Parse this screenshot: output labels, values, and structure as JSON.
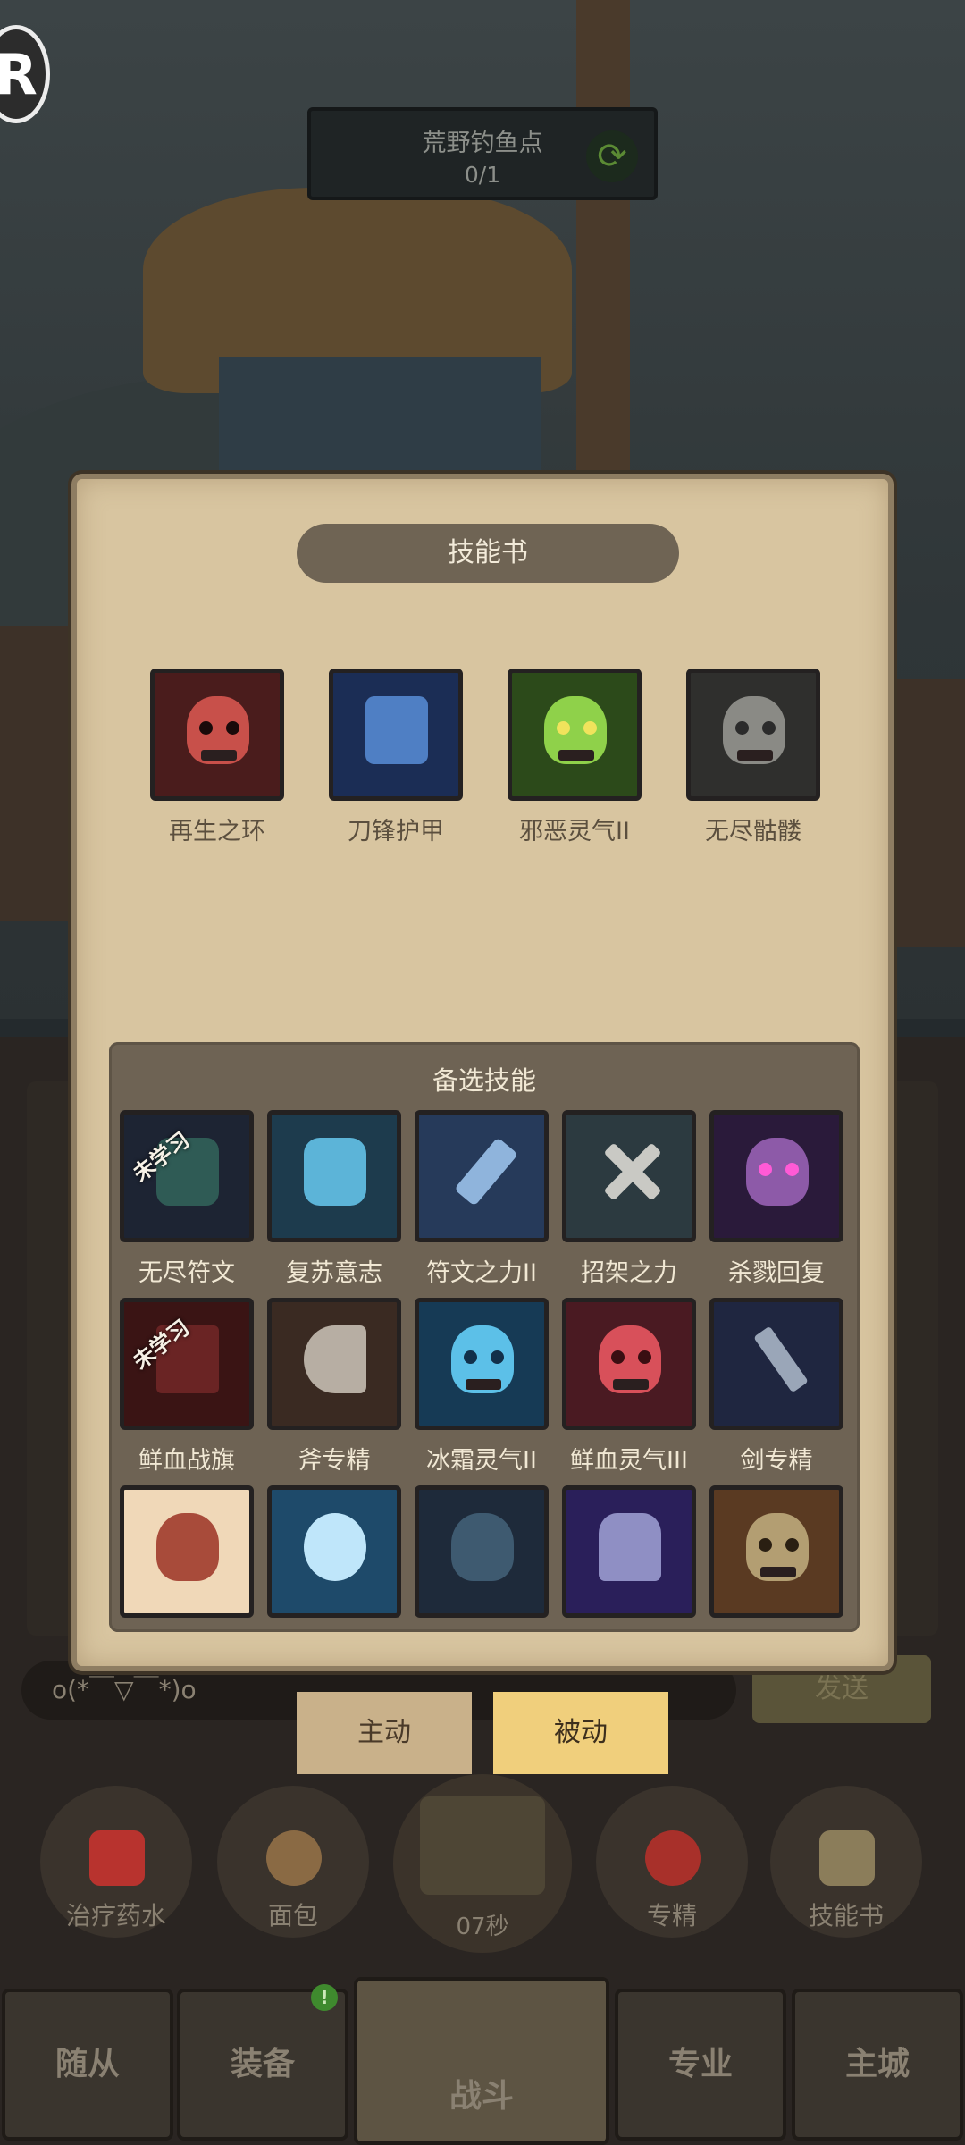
{
  "quest": {
    "title": "荒野钓鱼点",
    "progress": "0/1"
  },
  "badge": {
    "letter": "R"
  },
  "modal": {
    "title": "技能书",
    "equipped": [
      {
        "label": "再生之环",
        "icon": "red-skull-icon",
        "color": "#c8504a",
        "eye": "#1a0a0a"
      },
      {
        "label": "刀锋护甲",
        "icon": "blade-armor-icon",
        "color": "#4f7fc4",
        "eye": "#d9e2ee"
      },
      {
        "label": "邪恶灵气II",
        "icon": "green-skull-icon",
        "color": "#8fd14a",
        "eye": "#f0e35c"
      },
      {
        "label": "无尽骷髅",
        "icon": "grey-skull-icon",
        "color": "#8a8a85",
        "eye": "#2b2b2b"
      }
    ],
    "alternate_title": "备选技能",
    "alternate": [
      {
        "label": "无尽符文",
        "icon": "rune-stone-icon",
        "unlearned": "未学习",
        "color": "#2f5b55"
      },
      {
        "label": "复苏意志",
        "icon": "fist-icon",
        "unlearned": "",
        "color": "#5cb4d8"
      },
      {
        "label": "符文之力II",
        "icon": "rune-blade-icon",
        "unlearned": "",
        "color": "#8fb4dc"
      },
      {
        "label": "招架之力",
        "icon": "crossed-swords-icon",
        "unlearned": "",
        "color": "#6a8a95"
      },
      {
        "label": "杀戮回复",
        "icon": "demon-face-icon",
        "unlearned": "",
        "color": "#8d5aa8"
      },
      {
        "label": "鲜血战旗",
        "icon": "blood-banner-icon",
        "unlearned": "未学习",
        "color": "#6a2424"
      },
      {
        "label": "斧专精",
        "icon": "axe-icon",
        "unlearned": "",
        "color": "#b7aea3"
      },
      {
        "label": "冰霜灵气II",
        "icon": "ice-skull-icon",
        "unlearned": "",
        "color": "#5cc0e8"
      },
      {
        "label": "鲜血灵气III",
        "icon": "blood-skull-icon",
        "unlearned": "",
        "color": "#d8505a"
      },
      {
        "label": "剑专精",
        "icon": "sword-icon",
        "unlearned": "",
        "color": "#3a4a6e"
      },
      {
        "label": "",
        "icon": "horned-mask-icon",
        "unlearned": "",
        "color": "#a84b3a"
      },
      {
        "label": "",
        "icon": "light-orb-icon",
        "unlearned": "",
        "color": "#5ab0e0"
      },
      {
        "label": "",
        "icon": "fanged-maw-icon",
        "unlearned": "",
        "color": "#3e5a70"
      },
      {
        "label": "",
        "icon": "crystal-cage-icon",
        "unlearned": "",
        "color": "#5e4ca0"
      },
      {
        "label": "",
        "icon": "bone-skull-icon",
        "unlearned": "",
        "color": "#b39e72"
      }
    ]
  },
  "chat": {
    "text": "o(*￣▽￣*)o",
    "send_label": "发送"
  },
  "tabs": {
    "active": "主动",
    "passive": "被动"
  },
  "quick": [
    {
      "label": "治疗药水",
      "icon": "potion-icon",
      "color": "#b8332e"
    },
    {
      "label": "面包",
      "icon": "bread-icon",
      "color": "#8a6a44"
    },
    {
      "label": "专精",
      "icon": "mastery-icon",
      "color": "#a8302a"
    },
    {
      "label": "技能书",
      "icon": "skill-book-icon",
      "color": "#8b7d5a"
    }
  ],
  "chest": {
    "timer": "07秒"
  },
  "nav": {
    "companion": "随从",
    "equipment": "装备",
    "equipment_badge": "!",
    "battle": "战斗",
    "profession": "专业",
    "main_city": "主城"
  }
}
